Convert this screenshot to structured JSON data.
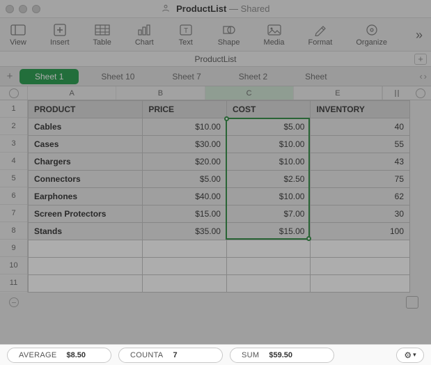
{
  "window": {
    "title_doc": "ProductList",
    "title_suffix": "— Shared"
  },
  "toolbar": {
    "view": "View",
    "insert": "Insert",
    "table": "Table",
    "chart": "Chart",
    "text": "Text",
    "shape": "Shape",
    "media": "Media",
    "format": "Format",
    "organize": "Organize"
  },
  "docname": "ProductList",
  "sheets": {
    "active": "Sheet 1",
    "others": [
      "Sheet 10",
      "Sheet 7",
      "Sheet 2",
      "Sheet"
    ]
  },
  "columns": [
    "A",
    "B",
    "C",
    "E"
  ],
  "selected_column_index": 2,
  "rows_shown": 11,
  "table": {
    "headers": [
      "PRODUCT",
      "PRICE",
      "COST",
      "INVENTORY"
    ],
    "rows": [
      {
        "name": "Cables",
        "price": "$10.00",
        "cost": "$5.00",
        "inventory": "40"
      },
      {
        "name": "Cases",
        "price": "$30.00",
        "cost": "$10.00",
        "inventory": "55"
      },
      {
        "name": "Chargers",
        "price": "$20.00",
        "cost": "$10.00",
        "inventory": "43"
      },
      {
        "name": "Connectors",
        "price": "$5.00",
        "cost": "$2.50",
        "inventory": "75"
      },
      {
        "name": "Earphones",
        "price": "$40.00",
        "cost": "$10.00",
        "inventory": "62"
      },
      {
        "name": "Screen Protectors",
        "price": "$15.00",
        "cost": "$7.00",
        "inventory": "30"
      },
      {
        "name": "Stands",
        "price": "$35.00",
        "cost": "$15.00",
        "inventory": "100"
      }
    ]
  },
  "status": {
    "average_label": "AVERAGE",
    "average_value": "$8.50",
    "counta_label": "COUNTA",
    "counta_value": "7",
    "sum_label": "SUM",
    "sum_value": "$59.50"
  }
}
